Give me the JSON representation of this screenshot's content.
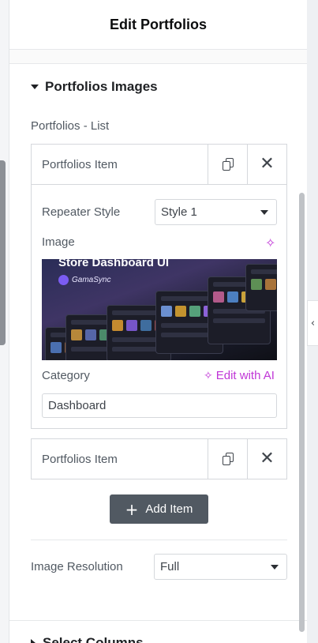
{
  "header": {
    "title": "Edit Portfolios"
  },
  "section": {
    "title": "Portfolios Images",
    "next_title": "Select Columns"
  },
  "repeater": {
    "label": "Portfolios - List",
    "items": [
      {
        "title": "Portfolios Item"
      },
      {
        "title": "Portfolios Item"
      }
    ],
    "add_label": "Add Item"
  },
  "item_fields": {
    "repeater_style_label": "Repeater Style",
    "repeater_style_value": "Style 1",
    "image_label": "Image",
    "image_preview": {
      "title": "Store Dashboard UI",
      "brand": "GamaSync"
    },
    "category_label": "Category",
    "category_value": "Dashboard",
    "edit_ai_label": "Edit with AI"
  },
  "image_resolution": {
    "label": "Image Resolution",
    "value": "Full"
  },
  "icons": {
    "copy": "copy-icon",
    "close": "close-icon",
    "ai": "sparkle-icon",
    "add": "plus-icon",
    "section_open": "caret-down-icon",
    "section_closed": "caret-right-icon",
    "collapse": "chevron-left-icon"
  },
  "colors": {
    "accent_ai": "#c036d7",
    "button": "#515962",
    "text": "#3f444b"
  }
}
